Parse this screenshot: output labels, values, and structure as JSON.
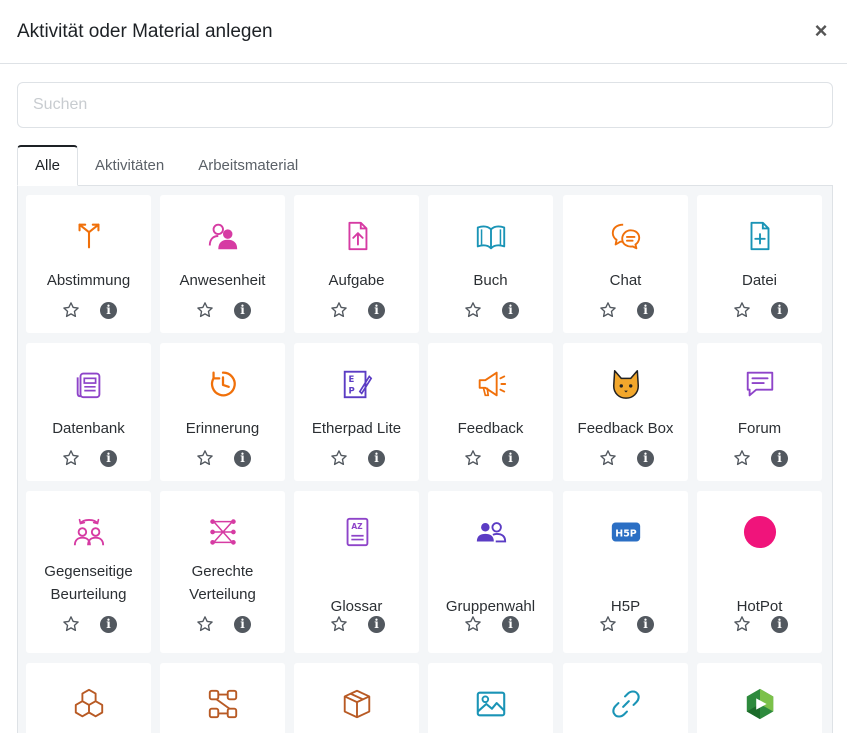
{
  "dialog": {
    "title": "Aktivität oder Material anlegen",
    "close_glyph": "×"
  },
  "search": {
    "placeholder": "Suchen",
    "value": ""
  },
  "tabs": [
    {
      "label": "Alle",
      "active": true
    },
    {
      "label": "Aktivitäten",
      "active": false
    },
    {
      "label": "Arbeitsmaterial",
      "active": false
    }
  ],
  "items": [
    {
      "label": "Abstimmung",
      "icon": "choice-icon",
      "color": "#f0700a"
    },
    {
      "label": "Anwesenheit",
      "icon": "attendance-icon",
      "color": "#d63ba3"
    },
    {
      "label": "Aufgabe",
      "icon": "assignment-icon",
      "color": "#d63ba3"
    },
    {
      "label": "Buch",
      "icon": "book-icon",
      "color": "#1a94b6"
    },
    {
      "label": "Chat",
      "icon": "chat-icon",
      "color": "#f0700a"
    },
    {
      "label": "Datei",
      "icon": "file-icon",
      "color": "#1a94b6"
    },
    {
      "label": "Datenbank",
      "icon": "database-icon",
      "color": "#8e44c9"
    },
    {
      "label": "Erinnerung",
      "icon": "reminder-icon",
      "color": "#f0700a"
    },
    {
      "label": "Etherpad Lite",
      "icon": "etherpad-icon",
      "color": "#5b3cc4"
    },
    {
      "label": "Feedback",
      "icon": "megaphone-icon",
      "color": "#f0700a"
    },
    {
      "label": "Feedback Box",
      "icon": "cat-icon",
      "color": "#f2a72c"
    },
    {
      "label": "Forum",
      "icon": "forum-icon",
      "color": "#8e44c9"
    },
    {
      "label": "Gegenseitige Beurteilung",
      "line1": "Gegenseitige",
      "line2": "Beurteilung",
      "icon": "peer-review-icon",
      "color": "#d63ba3"
    },
    {
      "label": "Gerechte Verteilung",
      "line1": "Gerechte",
      "line2": "Verteilung",
      "icon": "distribution-icon",
      "color": "#d63ba3"
    },
    {
      "label": "Glossar",
      "icon": "glossary-icon",
      "color": "#8e44c9"
    },
    {
      "label": "Gruppenwahl",
      "icon": "group-choice-icon",
      "color": "#5b3cc4"
    },
    {
      "label": "H5P",
      "icon": "h5p-icon",
      "color": "#2b6fc4"
    },
    {
      "label": "HotPot",
      "icon": "hotpot-icon",
      "color": "#f0147b"
    },
    {
      "label": "",
      "icon": "cubes-icon",
      "color": "#b85a24"
    },
    {
      "label": "",
      "icon": "network-icon",
      "color": "#b85a24"
    },
    {
      "label": "",
      "icon": "package-icon",
      "color": "#b85a24"
    },
    {
      "label": "",
      "icon": "image-icon",
      "color": "#1a94b6"
    },
    {
      "label": "",
      "icon": "link-icon",
      "color": "#1a94b6"
    },
    {
      "label": "",
      "icon": "video-play-icon",
      "color": "#2e8a3d"
    }
  ],
  "actions": {
    "info_glyph": "i"
  }
}
